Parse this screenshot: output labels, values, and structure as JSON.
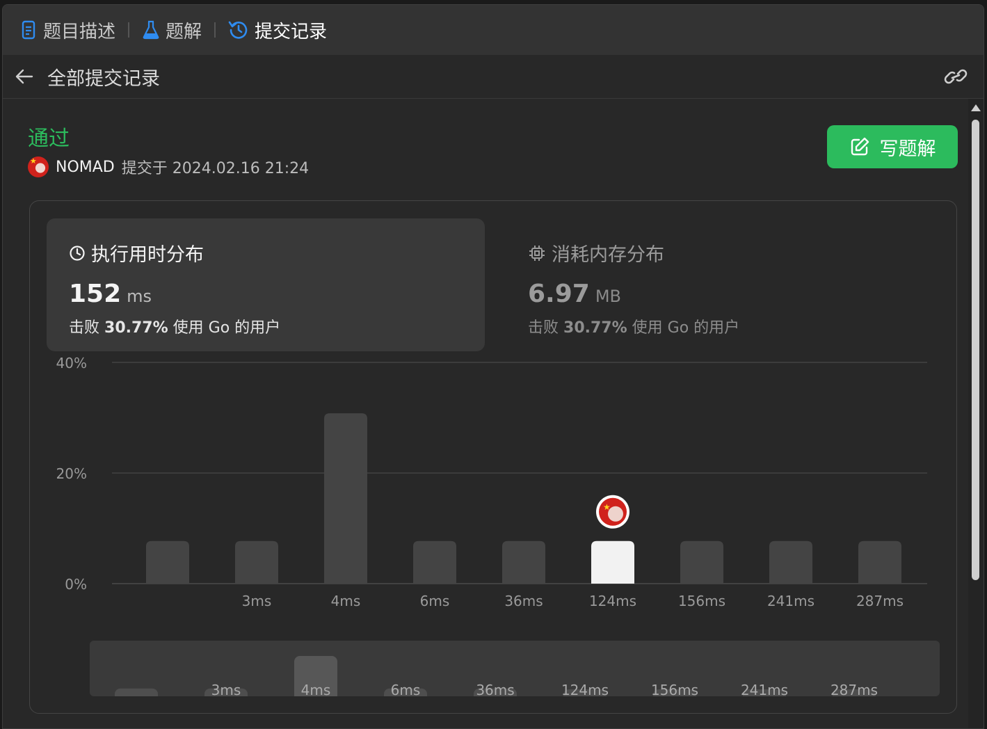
{
  "tabs": [
    {
      "label": "题目描述",
      "icon": "document-icon",
      "active": false
    },
    {
      "label": "题解",
      "icon": "flask-icon",
      "active": false
    },
    {
      "label": "提交记录",
      "icon": "history-icon",
      "active": true
    }
  ],
  "subheader": {
    "title": "全部提交记录"
  },
  "submission": {
    "status": "通过",
    "username": "NOMAD",
    "submitted_text": "提交于 2024.02.16 21:24"
  },
  "write_button": {
    "label": "写题解"
  },
  "runtime": {
    "title": "执行用时分布",
    "value": "152",
    "unit": "ms",
    "beat_prefix": "击败",
    "beat_percent": "30.77%",
    "beat_suffix": "使用 Go 的用户"
  },
  "memory": {
    "title": "消耗内存分布",
    "value": "6.97",
    "unit": "MB",
    "beat_prefix": "击败",
    "beat_percent": "30.77%",
    "beat_suffix": "使用 Go 的用户"
  },
  "colors": {
    "accent_green": "#2cbb5d",
    "bar": "#444444",
    "bar_highlight": "#f2f2f2",
    "active_tab_icon": "#2f8cf0"
  },
  "chart_data": {
    "type": "bar",
    "y_tick_labels": [
      "40%",
      "20%",
      "0%"
    ],
    "ylim": [
      0,
      40
    ],
    "grid": true,
    "categories": [
      "",
      "3ms",
      "4ms",
      "6ms",
      "36ms",
      "124ms",
      "156ms",
      "241ms",
      "287ms"
    ],
    "values": [
      7.7,
      7.7,
      30.8,
      7.7,
      7.7,
      7.7,
      7.7,
      7.7,
      7.7
    ],
    "highlight_category": "124ms",
    "brush_values": [
      1.5,
      1.5,
      7.7,
      1.5,
      1.5,
      0.5,
      0.5,
      0.5,
      0.5
    ]
  }
}
